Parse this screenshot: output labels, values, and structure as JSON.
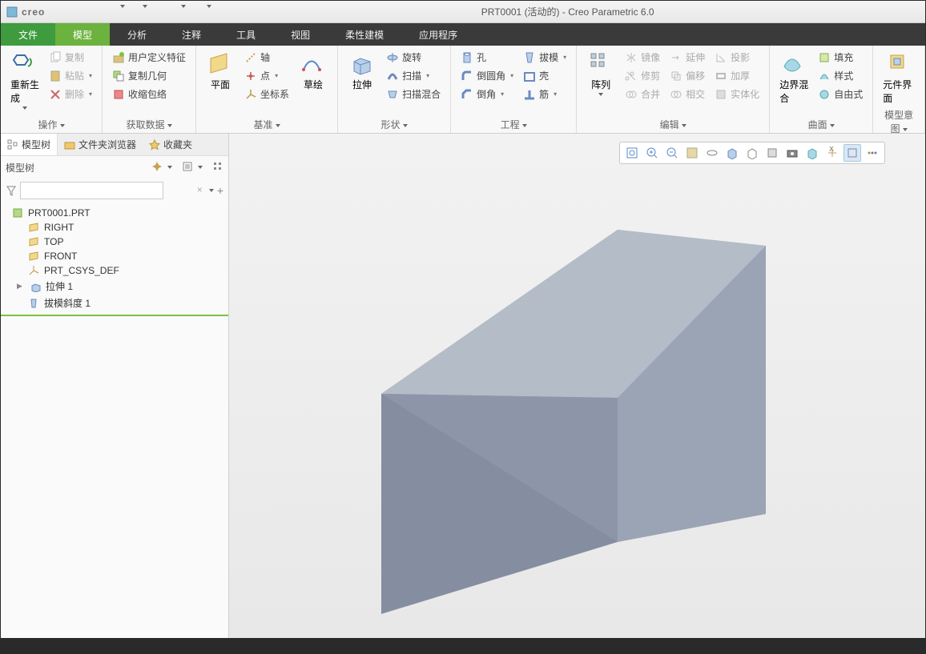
{
  "app_name": "creo",
  "window_title": "PRT0001 (活动的) - Creo Parametric 6.0",
  "tabs": {
    "file": "文件",
    "model": "模型",
    "analysis": "分析",
    "annotate": "注释",
    "tools": "工具",
    "view": "视图",
    "flex": "柔性建模",
    "app": "应用程序"
  },
  "ribbon": {
    "ops": {
      "label": "操作",
      "regen": "重新生成",
      "copy": "复制",
      "paste": "粘贴",
      "delete": "删除"
    },
    "getdata": {
      "label": "获取数据",
      "udf": "用户定义特征",
      "copygeo": "复制几何",
      "shrink": "收缩包络"
    },
    "datum": {
      "label": "基准",
      "plane": "平面",
      "sketch": "草绘",
      "axis": "轴",
      "point": "点",
      "csys": "坐标系"
    },
    "shape": {
      "label": "形状",
      "extrude": "拉伸",
      "revolve": "旋转",
      "sweep": "扫描",
      "sweepblend": "扫描混合"
    },
    "engineer": {
      "label": "工程",
      "hole": "孔",
      "round": "倒圆角",
      "chamfer": "倒角",
      "draft": "拔模",
      "shell": "壳",
      "rib": "筋"
    },
    "edit": {
      "label": "编辑",
      "pattern": "阵列",
      "mirror": "镜像",
      "trim": "修剪",
      "merge": "合并",
      "extend": "延伸",
      "offset": "偏移",
      "intersect": "相交",
      "project": "投影",
      "thicken": "加厚",
      "solidify": "实体化"
    },
    "surface": {
      "label": "曲面",
      "boundary": "边界混合",
      "fill": "填充",
      "style": "样式",
      "freeform": "自由式"
    },
    "intent": {
      "label": "模型意图",
      "component": "元件界面"
    }
  },
  "left": {
    "tabs": {
      "tree": "模型树",
      "folder": "文件夹浏览器",
      "fav": "收藏夹"
    },
    "header": "模型树",
    "root": "PRT0001.PRT",
    "nodes": {
      "right": "RIGHT",
      "top": "TOP",
      "front": "FRONT",
      "csys": "PRT_CSYS_DEF",
      "extrude": "拉伸 1",
      "draft": "拔模斜度 1"
    }
  }
}
